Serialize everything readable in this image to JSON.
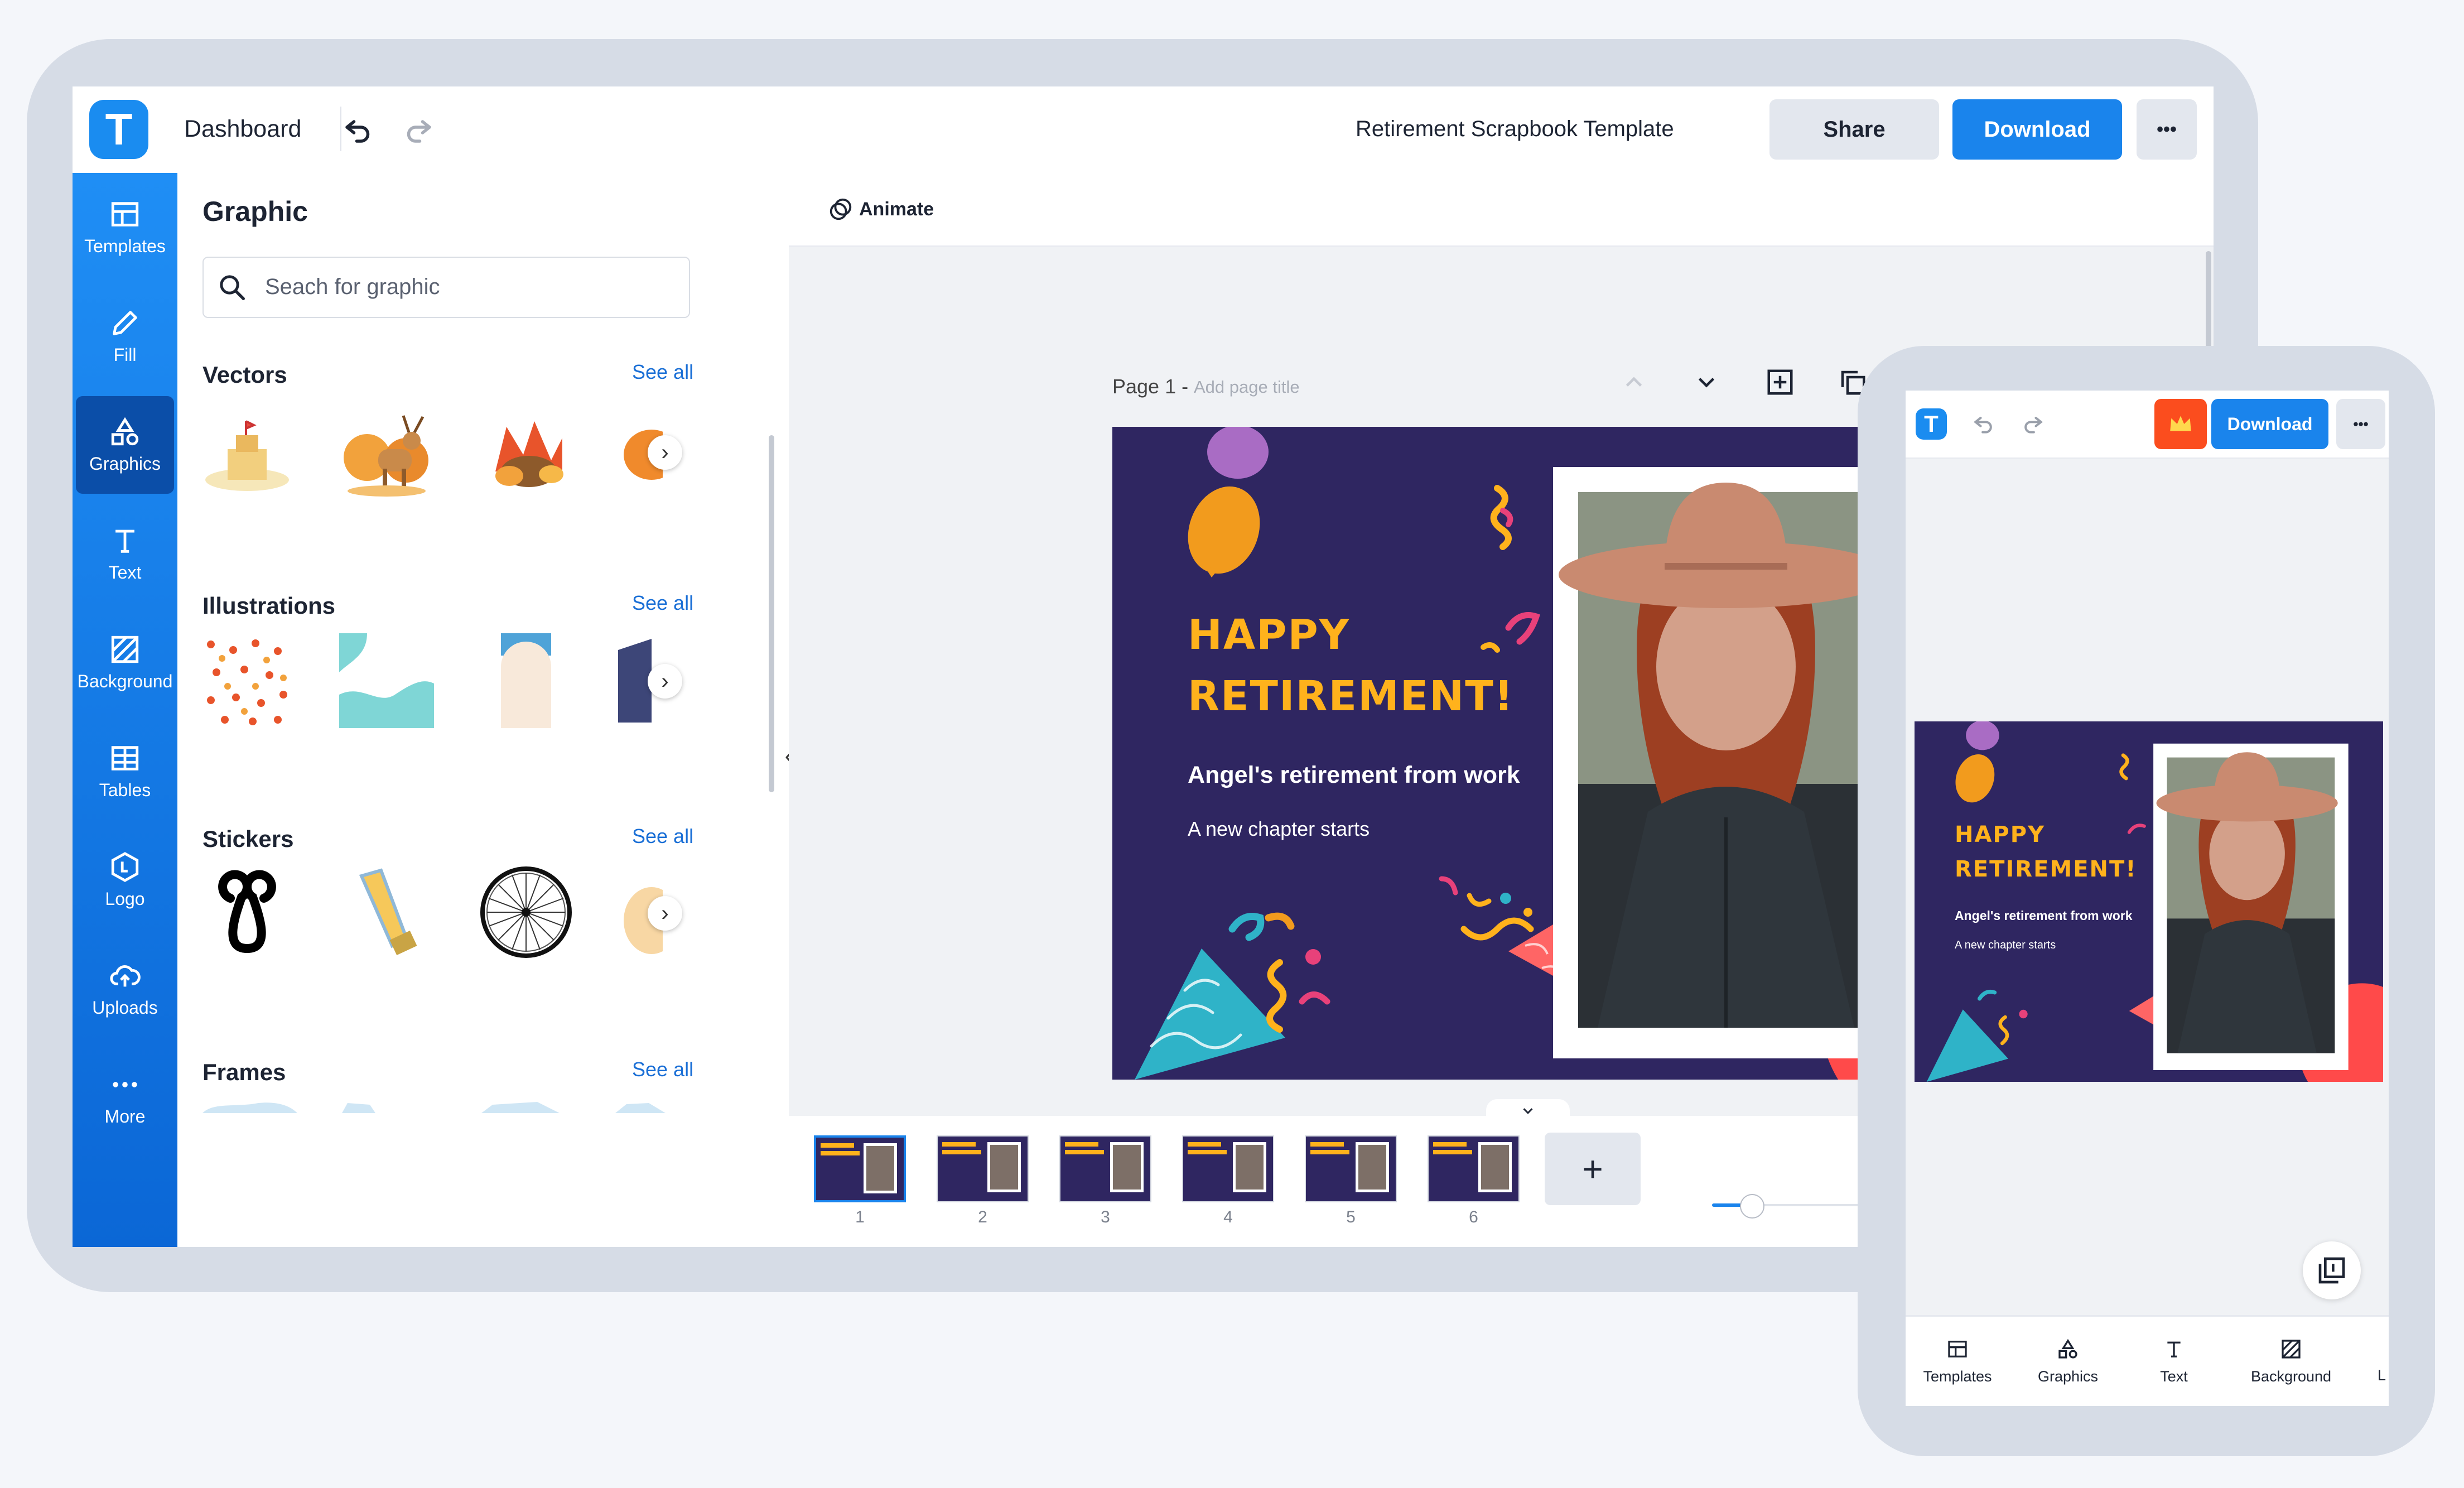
{
  "app": {
    "logo_letter": "T",
    "brand_color": "#1a8cf0"
  },
  "topbar": {
    "dashboard": "Dashboard",
    "doc_title": "Retirement Scrapbook Template",
    "share": "Share",
    "download": "Download",
    "more": "•••"
  },
  "rail": {
    "items": [
      {
        "label": "Templates",
        "icon": "templates-icon"
      },
      {
        "label": "Fill",
        "icon": "pencil-icon"
      },
      {
        "label": "Graphics",
        "icon": "shapes-icon"
      },
      {
        "label": "Text",
        "icon": "text-icon"
      },
      {
        "label": "Background",
        "icon": "background-icon"
      },
      {
        "label": "Tables",
        "icon": "table-icon"
      },
      {
        "label": "Logo",
        "icon": "logo-icon"
      },
      {
        "label": "Uploads",
        "icon": "cloud-upload-icon"
      },
      {
        "label": "More",
        "icon": "more-icon"
      }
    ]
  },
  "panel": {
    "title": "Graphic",
    "search_placeholder": "Seach for graphic",
    "sections": [
      {
        "title": "Vectors",
        "see_all": "See all"
      },
      {
        "title": "Illustrations",
        "see_all": "See all"
      },
      {
        "title": "Stickers",
        "see_all": "See all"
      },
      {
        "title": "Frames",
        "see_all": "See all"
      }
    ]
  },
  "canvas": {
    "animate": "Animate",
    "page_label": "Page 1 -",
    "page_title_placeholder": "Add page title",
    "slide": {
      "title_line1": "HAPPY",
      "title_line2": "RETIREMENT!",
      "subtitle": "Angel's retirement from work",
      "tagline": "A new chapter starts",
      "bg_color": "#2f2661",
      "accent": "#ffb21c"
    },
    "pages": [
      "1",
      "2",
      "3",
      "4",
      "5",
      "6"
    ],
    "add_page": "+"
  },
  "phone": {
    "download": "Download",
    "more": "•••",
    "slide": {
      "title_line1": "HAPPY",
      "title_line2": "RETIREMENT!",
      "subtitle": "Angel's retirement from work",
      "tagline": "A new chapter starts"
    },
    "nav": [
      {
        "label": "Templates",
        "icon": "templates-icon"
      },
      {
        "label": "Graphics",
        "icon": "shapes-icon"
      },
      {
        "label": "Text",
        "icon": "text-icon"
      },
      {
        "label": "Background",
        "icon": "background-icon"
      },
      {
        "label": "L",
        "icon": "cut-off-item"
      }
    ]
  }
}
